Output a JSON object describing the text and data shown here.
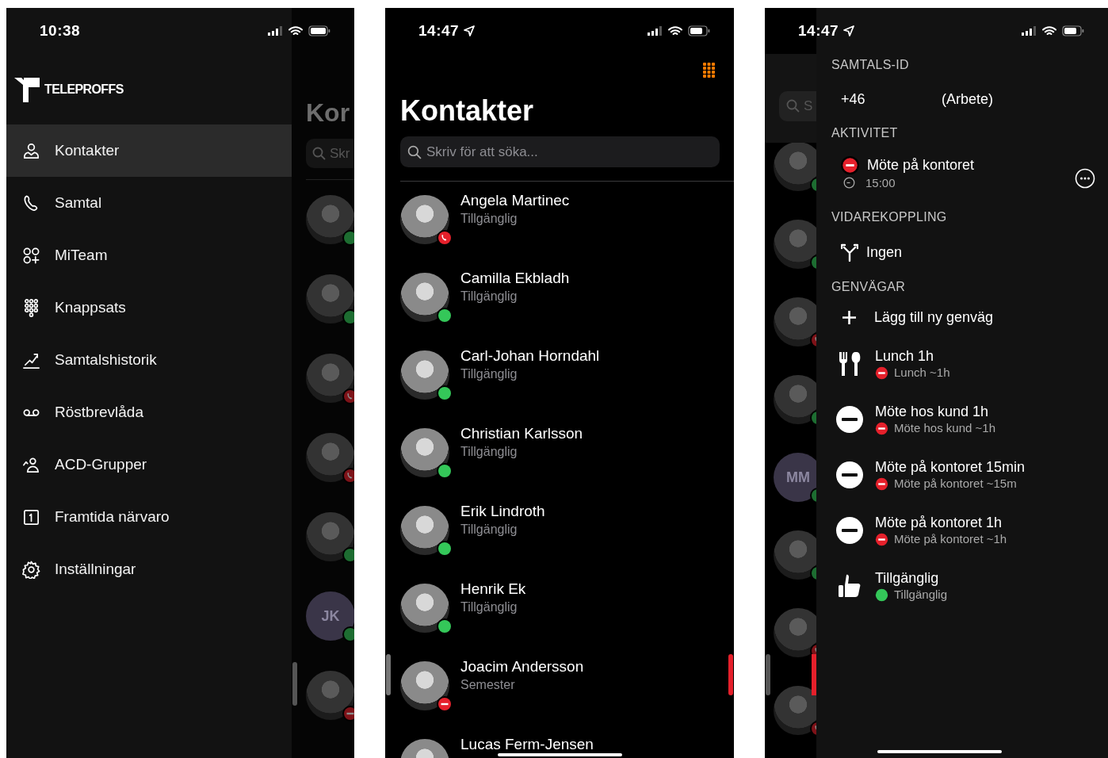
{
  "menu_screen": {
    "status_bar": {
      "time": "10:38"
    },
    "logo": "TELEPROFFS",
    "menu": [
      {
        "label": "Kontakter",
        "selected": true
      },
      {
        "label": "Samtal",
        "selected": false
      },
      {
        "label": "MiTeam",
        "selected": false
      },
      {
        "label": "Knappsats",
        "selected": false
      },
      {
        "label": "Samtalshistorik",
        "selected": false
      },
      {
        "label": "Röstbrevlåda",
        "selected": false
      },
      {
        "label": "ACD-Grupper",
        "selected": false
      },
      {
        "label": "Framtida närvaro",
        "selected": false
      },
      {
        "label": "Inställningar",
        "selected": false
      }
    ],
    "behind": {
      "title": "Kor",
      "search": {
        "placeholder": "Skr"
      },
      "avatars": [
        {
          "kind": "available"
        },
        {
          "kind": "available"
        },
        {
          "kind": "call"
        },
        {
          "kind": "call"
        },
        {
          "kind": "available"
        },
        {
          "kind": "available",
          "initials": "JK"
        },
        {
          "kind": "busy"
        }
      ]
    }
  },
  "contacts_screen": {
    "status_bar": {
      "time": "14:47",
      "location": true
    },
    "title": "Kontakter",
    "search": {
      "placeholder": "Skriv för att söka..."
    },
    "contacts": [
      {
        "name": "Angela Martinec",
        "presence": "Tillgänglig",
        "kind": "call"
      },
      {
        "name": "Camilla Ekbladh",
        "presence": "Tillgänglig",
        "kind": "available"
      },
      {
        "name": "Carl-Johan Horndahl",
        "presence": "Tillgänglig",
        "kind": "available"
      },
      {
        "name": "Christian Karlsson",
        "presence": "Tillgänglig",
        "kind": "available"
      },
      {
        "name": "Erik Lindroth",
        "presence": "Tillgänglig",
        "kind": "available"
      },
      {
        "name": "Henrik Ek",
        "presence": "Tillgänglig",
        "kind": "available"
      },
      {
        "name": "Joacim Andersson",
        "presence": "Semester",
        "kind": "busy"
      },
      {
        "name": "Lucas Ferm-Jensen"
      }
    ]
  },
  "activity_screen": {
    "status_bar": {
      "time": "14:47",
      "location": true
    },
    "behind": {
      "search": {
        "placeholder": "S"
      },
      "avatars": [
        {
          "kind": "available"
        },
        {
          "kind": "available"
        },
        {
          "kind": "call"
        },
        {
          "kind": "available"
        },
        {
          "kind": "available",
          "initials": "MM"
        },
        {
          "kind": "available"
        },
        {
          "kind": "call"
        },
        {
          "kind": "call"
        }
      ]
    },
    "caller_id": {
      "heading": "SAMTALS-ID",
      "number": "+46",
      "label": "(Arbete)"
    },
    "activity": {
      "heading": "AKTIVITET",
      "name": "Möte på kontoret",
      "kind": "busy",
      "until": "15:00"
    },
    "forwarding": {
      "heading": "VIDAREKOPPLING",
      "value": "Ingen"
    },
    "shortcuts": {
      "heading": "GENVÄGAR",
      "add_label": "Lägg till ny genväg",
      "items": [
        {
          "kind": "lunch",
          "title": "Lunch 1h",
          "color": "#e5202b",
          "subtitle": "Lunch ~1h"
        },
        {
          "kind": "busy",
          "title": "Möte hos kund 1h",
          "color": "#e5202b",
          "subtitle": "Möte hos kund ~1h"
        },
        {
          "kind": "busy",
          "title": "Möte på kontoret 15min",
          "color": "#e5202b",
          "subtitle": "Möte på kontoret ~15m"
        },
        {
          "kind": "busy",
          "title": "Möte på kontoret 1h",
          "color": "#e5202b",
          "subtitle": "Möte på kontoret ~1h"
        },
        {
          "kind": "available",
          "title": "Tillgänglig",
          "color": "#34c759",
          "subtitle": "Tillgänglig"
        }
      ]
    }
  }
}
